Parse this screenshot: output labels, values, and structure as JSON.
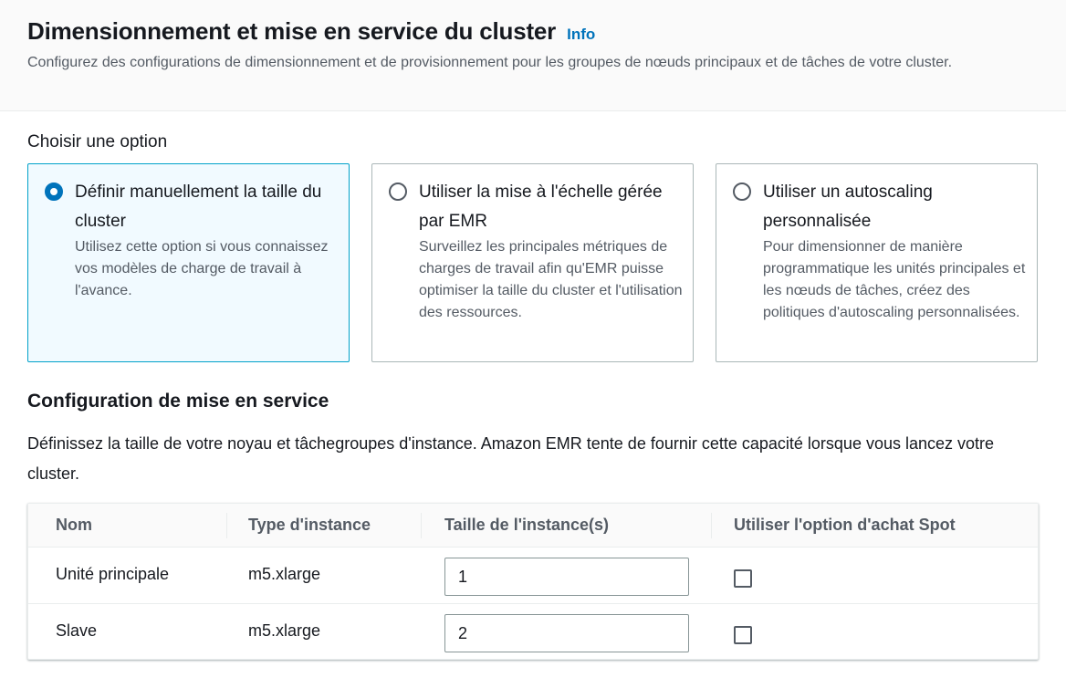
{
  "header": {
    "title": "Dimensionnement et mise en service du cluster",
    "info_link": "Info",
    "description": "Configurez des configurations de dimensionnement et de provisionnement pour les groupes de nœuds principaux et de tâches de votre cluster."
  },
  "options": {
    "label": "Choisir une option",
    "selected_index": 0,
    "items": [
      {
        "title": "Définir manuellement la taille du cluster",
        "description": "Utilisez cette option si vous connaissez vos modèles de charge de travail à l'avance."
      },
      {
        "title": "Utiliser la mise à l'échelle gérée par EMR",
        "description": "Surveillez les principales métriques de charges de travail afin qu'EMR puisse optimiser la taille du cluster et l'utilisation des ressources."
      },
      {
        "title": "Utiliser un autoscaling personnalisée",
        "description": "Pour dimensionner de manière programmatique les unités principales et les nœuds de tâches, créez des politiques d'autoscaling personnalisées."
      }
    ]
  },
  "provisioning": {
    "title": "Configuration de mise en service",
    "description": "Définissez la taille de votre noyau et tâchegroupes d'instance. Amazon EMR tente de fournir cette capacité lorsque vous lancez votre cluster.",
    "columns": [
      "Nom",
      "Type d'instance",
      "Taille de l'instance(s)",
      "Utiliser l'option d'achat Spot"
    ],
    "rows": [
      {
        "name": "Unité principale",
        "instance_type": "m5.xlarge",
        "size": "1",
        "spot": false
      },
      {
        "name": "Slave",
        "instance_type": "m5.xlarge",
        "size": "2",
        "spot": false
      }
    ]
  },
  "colors": {
    "accent": "#0073bb",
    "selected_border": "#00a1c9",
    "selected_background": "#f1faff"
  }
}
